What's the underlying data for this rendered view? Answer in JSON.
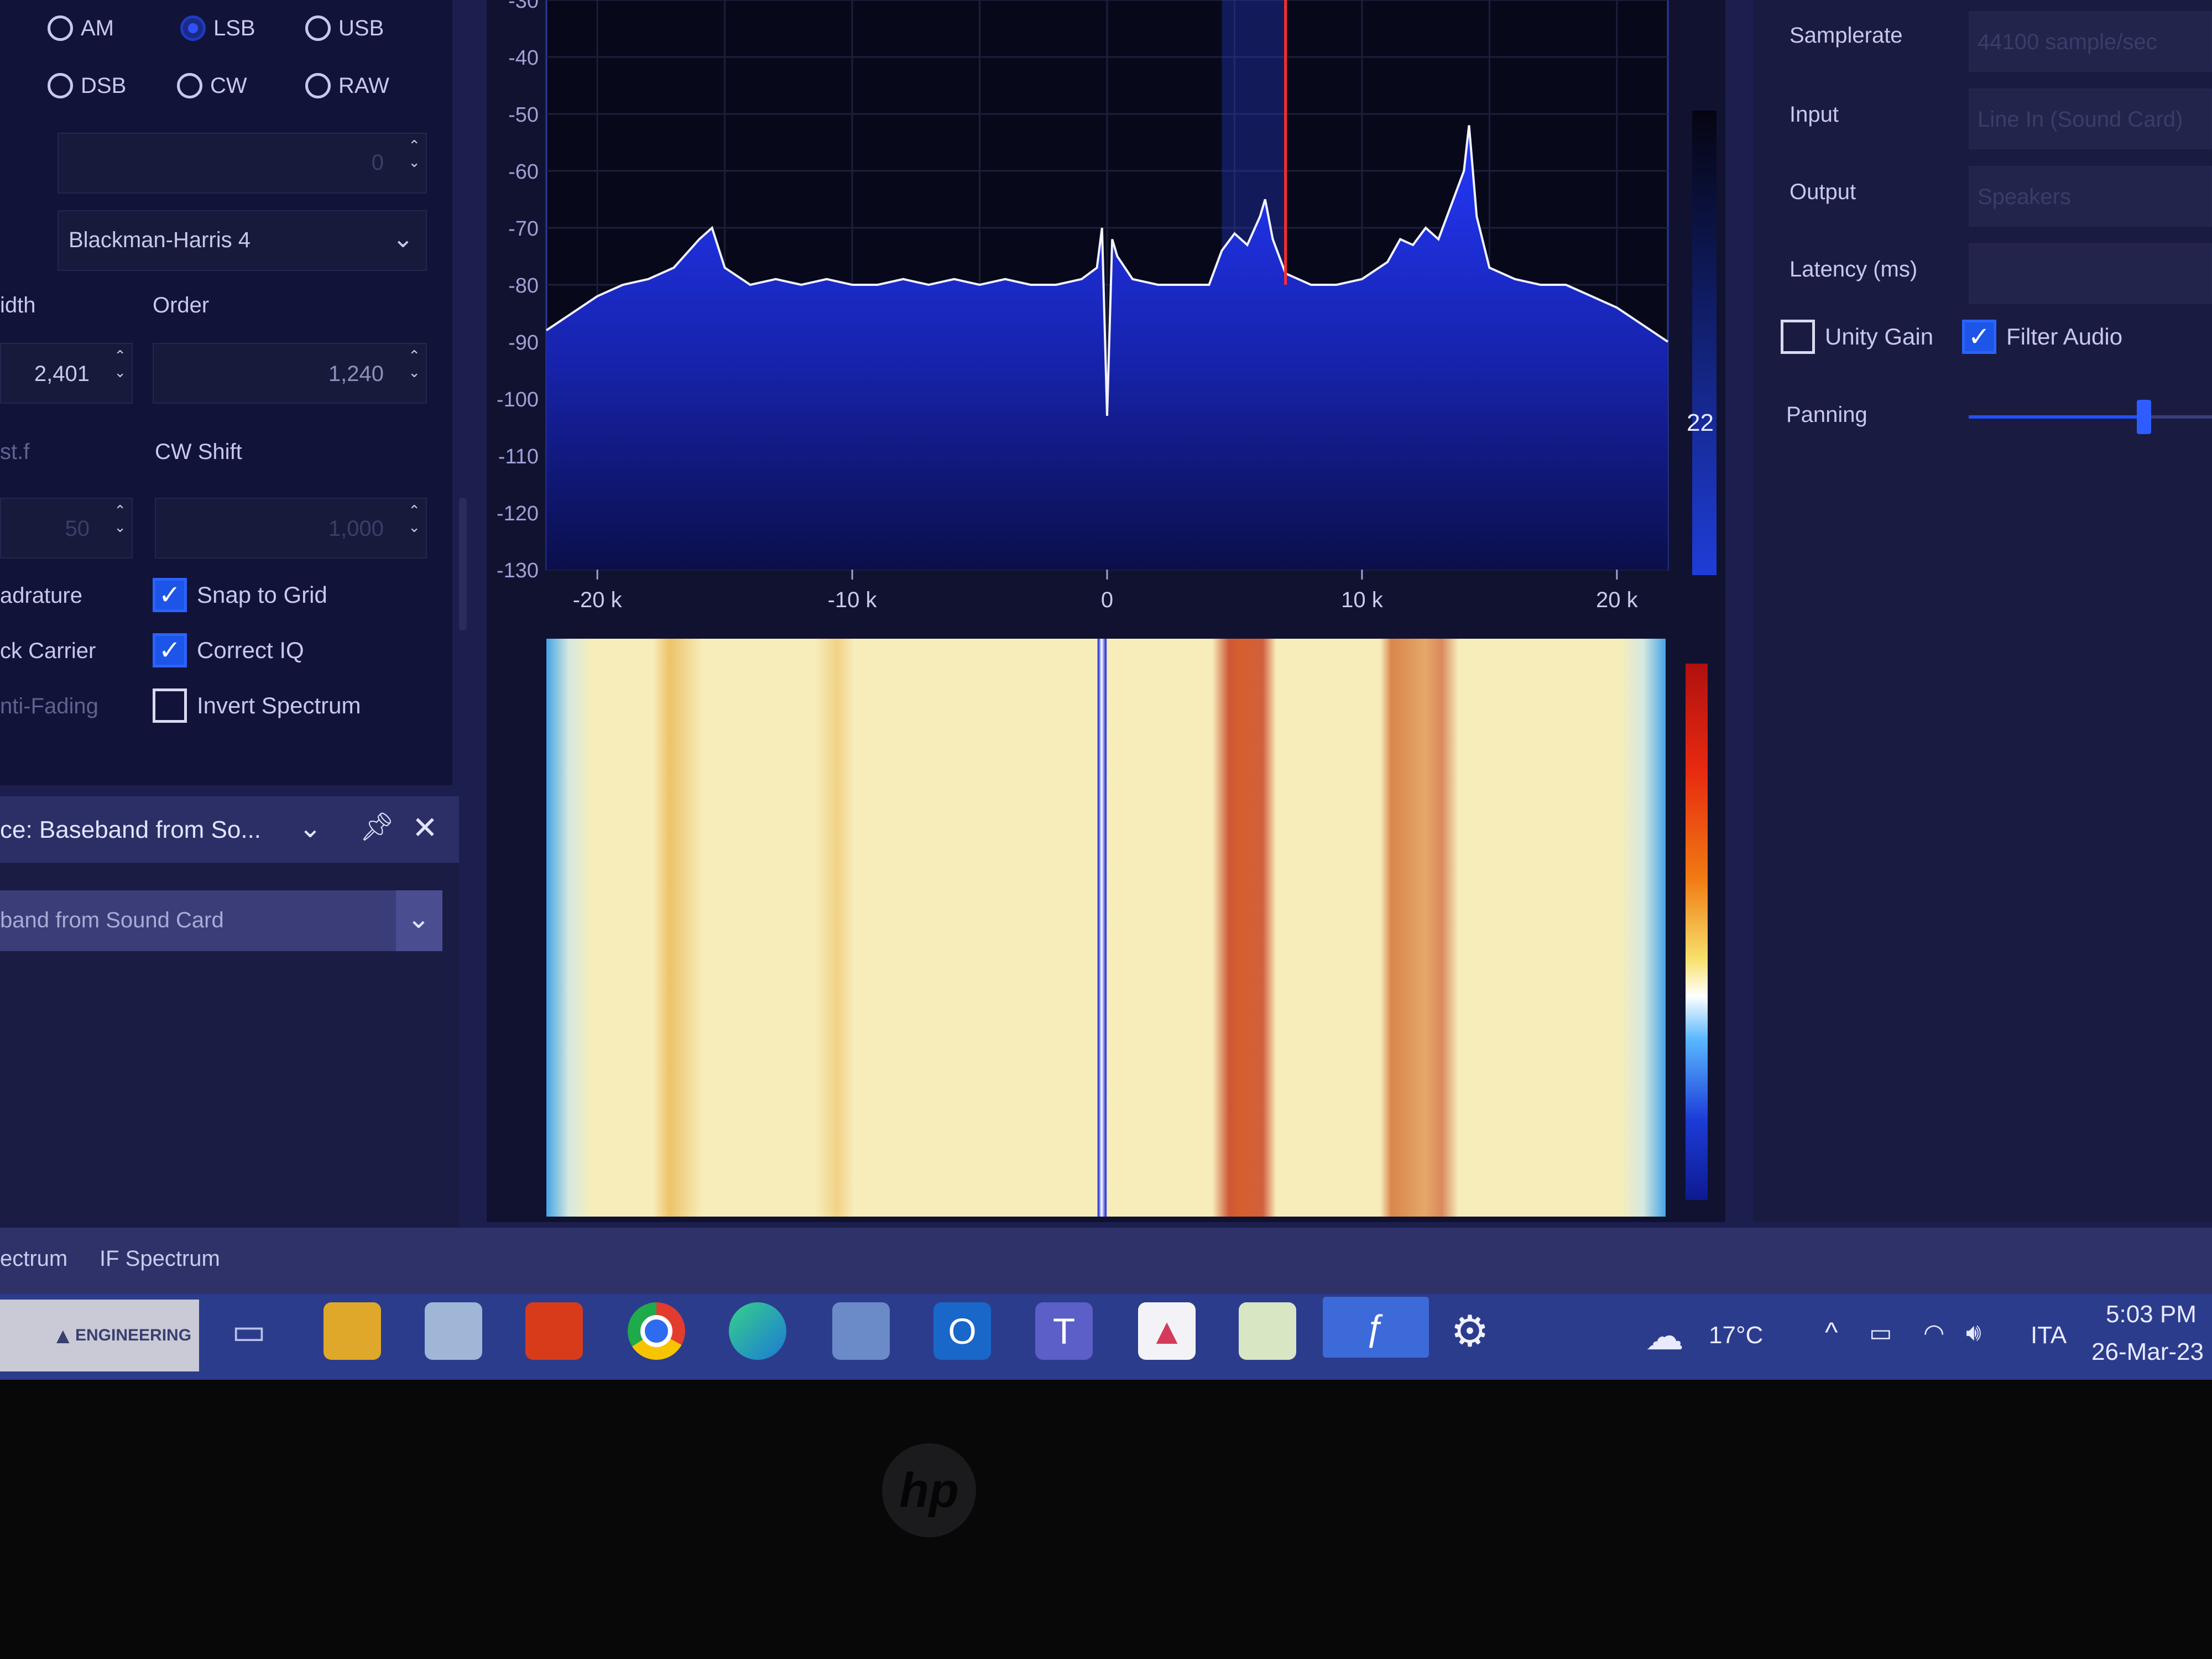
{
  "demod": {
    "modes": [
      {
        "label": "AM",
        "selected": false
      },
      {
        "label": "LSB",
        "selected": true
      },
      {
        "label": "USB",
        "selected": false
      },
      {
        "label": "DSB",
        "selected": false
      },
      {
        "label": "CW",
        "selected": false
      },
      {
        "label": "RAW",
        "selected": false
      }
    ],
    "field1_value": "0",
    "window_select": "Blackman-Harris 4",
    "width_label": "idth",
    "order_label": "Order",
    "width_value": "2,401",
    "order_value": "1,240",
    "shift_label": "st.f",
    "cw_shift_label": "CW Shift",
    "shift_value": "50",
    "cw_shift_value": "1,000",
    "checks": [
      {
        "label": "adrature",
        "checked": null
      },
      {
        "label": "Snap to Grid",
        "checked": true
      },
      {
        "label": "ck Carrier",
        "checked": null
      },
      {
        "label": "Correct IQ",
        "checked": true
      },
      {
        "label": "nti-Fading",
        "checked": null
      },
      {
        "label": "Invert Spectrum",
        "checked": false
      }
    ]
  },
  "source_panel": {
    "title": "ce: Baseband from So...",
    "select": "band from Sound Card"
  },
  "audio": {
    "samplerate_label": "Samplerate",
    "samplerate_value": "44100 sample/sec",
    "input_label": "Input",
    "input_value": "Line In (Sound Card)",
    "output_label": "Output",
    "output_value": "Speakers",
    "latency_label": "Latency (ms)",
    "unity_gain_label": "Unity Gain",
    "unity_gain_checked": false,
    "filter_audio_label": "Filter Audio",
    "filter_audio_checked": true,
    "panning_label": "Panning",
    "panning_level": 0.72
  },
  "spectrum": {
    "side_value": "22",
    "colors": {
      "fill": "#1d2ed0",
      "trace": "#f1f2ff",
      "cursor": "#ff2d2d",
      "grid": "#1b1f3a"
    }
  },
  "bottom_tabs": [
    "ectrum",
    "IF Spectrum"
  ],
  "taskbar": {
    "brand": "ENGINEERING",
    "temperature": "17°C",
    "language": "ITA",
    "time": "5:03 PM",
    "date": "26-Mar-23"
  },
  "chart_data": {
    "type": "area",
    "title": "",
    "xlabel": "",
    "ylabel": "",
    "xlim": [
      -22,
      22
    ],
    "ylim": [
      -130,
      -30
    ],
    "x_ticks": [
      {
        "value": -20,
        "label": "-20 k"
      },
      {
        "value": -10,
        "label": "-10 k"
      },
      {
        "value": 0,
        "label": "0"
      },
      {
        "value": 10,
        "label": "10 k"
      },
      {
        "value": 20,
        "label": "20 k"
      }
    ],
    "y_ticks": [
      -30,
      -40,
      -50,
      -60,
      -70,
      -80,
      -90,
      -100,
      -110,
      -120,
      -130
    ],
    "grid": true,
    "highlight_band": [
      4.5,
      7
    ],
    "cursor_x": 7,
    "series": [
      {
        "x": [
          -22,
          -21,
          -20,
          -19,
          -18,
          -17,
          -16,
          -15.5,
          -15,
          -14,
          -13,
          -12,
          -11,
          -10,
          -9,
          -8,
          -7,
          -6,
          -5,
          -4,
          -3,
          -2,
          -1,
          -0.4,
          -0.2,
          0,
          0.2,
          0.4,
          1,
          2,
          3,
          4,
          4.5,
          5,
          5.5,
          6,
          6.2,
          6.5,
          7,
          8,
          9,
          10,
          11,
          11.5,
          12,
          12.5,
          13,
          13.5,
          14,
          14.2,
          14.5,
          15,
          16,
          17,
          18,
          19,
          20,
          21,
          22
        ],
        "y": [
          -88,
          -85,
          -82,
          -80,
          -79,
          -77,
          -72,
          -70,
          -77,
          -80,
          -79,
          -80,
          -79,
          -80,
          -80,
          -79,
          -80,
          -79,
          -80,
          -79,
          -80,
          -80,
          -79,
          -77,
          -70,
          -103,
          -72,
          -75,
          -79,
          -80,
          -80,
          -80,
          -74,
          -71,
          -73,
          -68,
          -65,
          -72,
          -78,
          -80,
          -80,
          -79,
          -76,
          -72,
          -73,
          -70,
          -72,
          -66,
          -60,
          -52,
          -68,
          -77,
          -79,
          -80,
          -80,
          -82,
          -84,
          -87,
          -90
        ]
      }
    ]
  }
}
